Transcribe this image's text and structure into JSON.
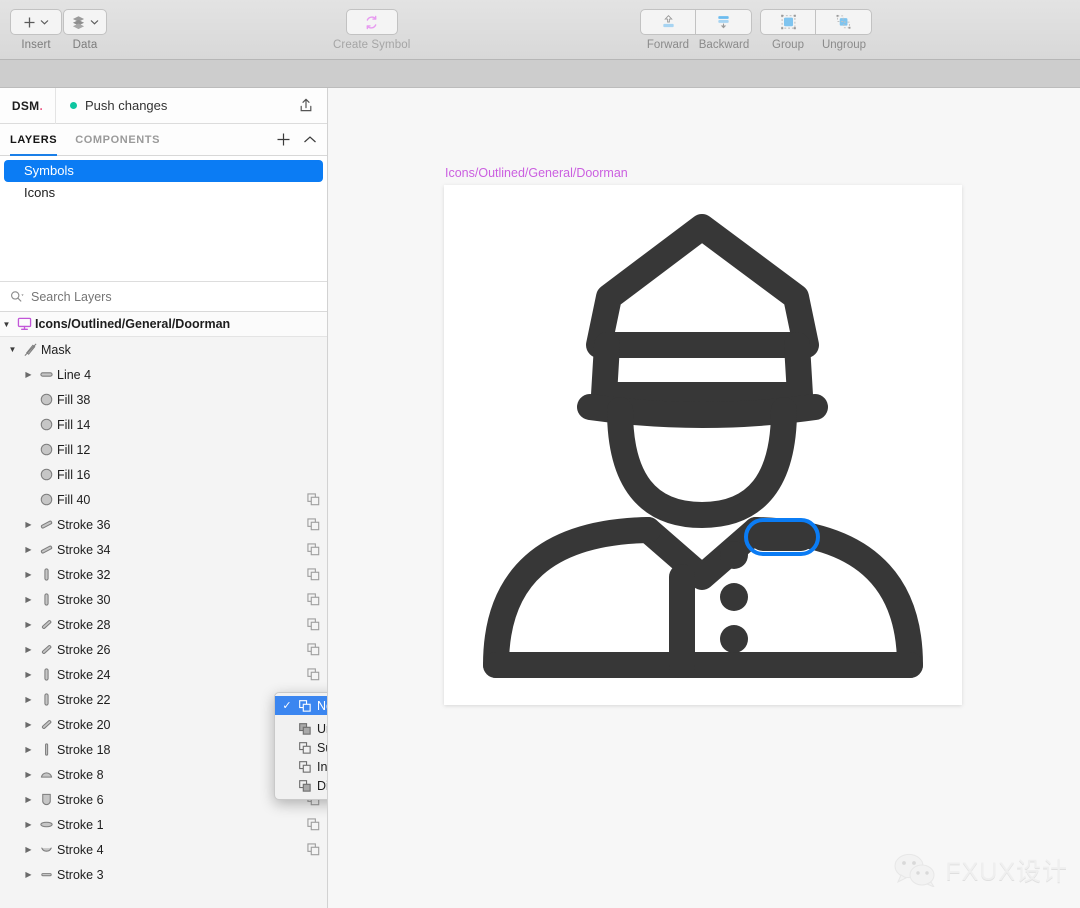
{
  "toolbar": {
    "groups": [
      {
        "name": "insert",
        "label": "Insert",
        "icon": "plus-icon"
      },
      {
        "name": "data",
        "label": "Data",
        "icon": "layers-stack-icon"
      },
      {
        "name": "create-symbol",
        "label": "Create Symbol",
        "icon": "create-symbol-icon"
      }
    ],
    "arrange": {
      "forward_label": "Forward",
      "backward_label": "Backward",
      "group_label": "Group",
      "ungroup_label": "Ungroup"
    }
  },
  "panel": {
    "logo": "DSM",
    "logo_dot": ".",
    "push_label": "Push changes",
    "push_status_color": "#0ec6a0",
    "share_icon": "share-upload-icon",
    "tabs": [
      {
        "label": "LAYERS",
        "active": true
      },
      {
        "label": "COMPONENTS",
        "active": false
      }
    ],
    "tab_actions": [
      {
        "name": "add-button",
        "glyph": "+"
      },
      {
        "name": "collapse-button",
        "glyph": "⌃"
      }
    ],
    "symbols": [
      {
        "label": "Symbols",
        "selected": true
      },
      {
        "label": "Icons",
        "selected": false
      }
    ],
    "search": {
      "placeholder": "Search Layers",
      "value": "",
      "icon": "search-icon"
    },
    "accent_color": "#0b7cf4"
  },
  "layers": {
    "root": {
      "name": "Icons/Outlined/General/Doorman",
      "icon": "artboard-icon",
      "icon_color": "#c256d8",
      "expanded": true
    },
    "rows": [
      {
        "name": "Mask",
        "icon": "mask-icon",
        "indent": 1,
        "triangle": "open",
        "bool": false
      },
      {
        "name": "Line 4",
        "icon": "pill-icon",
        "indent": 2,
        "triangle": "closed",
        "bool": false
      },
      {
        "name": "Fill 38",
        "icon": "circle-icon",
        "indent": 2,
        "triangle": "none",
        "bool": false
      },
      {
        "name": "Fill 14",
        "icon": "circle-icon",
        "indent": 2,
        "triangle": "none",
        "bool": false
      },
      {
        "name": "Fill 12",
        "icon": "circle-icon",
        "indent": 2,
        "triangle": "none",
        "bool": false
      },
      {
        "name": "Fill 16",
        "icon": "circle-icon",
        "indent": 2,
        "triangle": "none",
        "bool": false
      },
      {
        "name": "Fill 40",
        "icon": "circle-icon",
        "indent": 2,
        "triangle": "none",
        "bool": true
      },
      {
        "name": "Stroke 36",
        "icon": "diag-stroke-icon",
        "indent": 2,
        "triangle": "closed",
        "bool": true
      },
      {
        "name": "Stroke 34",
        "icon": "diag-stroke-icon",
        "indent": 2,
        "triangle": "closed",
        "bool": true
      },
      {
        "name": "Stroke 32",
        "icon": "vbar-icon",
        "indent": 2,
        "triangle": "closed",
        "bool": true
      },
      {
        "name": "Stroke 30",
        "icon": "vbar-icon",
        "indent": 2,
        "triangle": "closed",
        "bool": true
      },
      {
        "name": "Stroke 28",
        "icon": "slash-icon",
        "indent": 2,
        "triangle": "closed",
        "bool": true
      },
      {
        "name": "Stroke 26",
        "icon": "slash-icon",
        "indent": 2,
        "triangle": "closed",
        "bool": true
      },
      {
        "name": "Stroke 24",
        "icon": "vbar-icon",
        "indent": 2,
        "triangle": "closed",
        "bool": true
      },
      {
        "name": "Stroke 22",
        "icon": "vbar-icon",
        "indent": 2,
        "triangle": "closed",
        "bool": true
      },
      {
        "name": "Stroke 20",
        "icon": "slash-icon",
        "indent": 2,
        "triangle": "closed",
        "bool": true
      },
      {
        "name": "Stroke 18",
        "icon": "thin-vbar-icon",
        "indent": 2,
        "triangle": "closed",
        "bool": true
      },
      {
        "name": "Stroke 8",
        "icon": "arc-cap-icon",
        "indent": 2,
        "triangle": "closed",
        "bool": true
      },
      {
        "name": "Stroke 6",
        "icon": "shield-icon",
        "indent": 2,
        "triangle": "closed",
        "bool": true
      },
      {
        "name": "Stroke 1",
        "icon": "ellipse-cap-icon",
        "indent": 2,
        "triangle": "closed",
        "bool": true
      },
      {
        "name": "Stroke 4",
        "icon": "smile-arc-icon",
        "indent": 2,
        "triangle": "closed",
        "bool": true
      },
      {
        "name": "Stroke 3",
        "icon": "dash-icon",
        "indent": 2,
        "triangle": "closed",
        "bool": false
      }
    ]
  },
  "context_menu": {
    "items": [
      {
        "label": "None",
        "icon": "boolean-none-icon",
        "selected": true,
        "checked": true
      },
      {
        "label": "Union",
        "icon": "boolean-union-icon",
        "selected": false,
        "checked": false
      },
      {
        "label": "Subtract",
        "icon": "boolean-subtract-icon",
        "selected": false,
        "checked": false
      },
      {
        "label": "Intersect",
        "icon": "boolean-intersect-icon",
        "selected": false,
        "checked": false
      },
      {
        "label": "Difference",
        "icon": "boolean-difference-icon",
        "selected": false,
        "checked": false
      }
    ],
    "highlight_color": "#3b86f0"
  },
  "canvas": {
    "artboard_label": "Icons/Outlined/General/Doorman",
    "artboard_label_color": "#cb5fe0",
    "artboard_background": "#ffffff",
    "illustration_color": "#373737",
    "selection_color": "#0b7cf4",
    "watermark_text": "FXUX设计"
  }
}
